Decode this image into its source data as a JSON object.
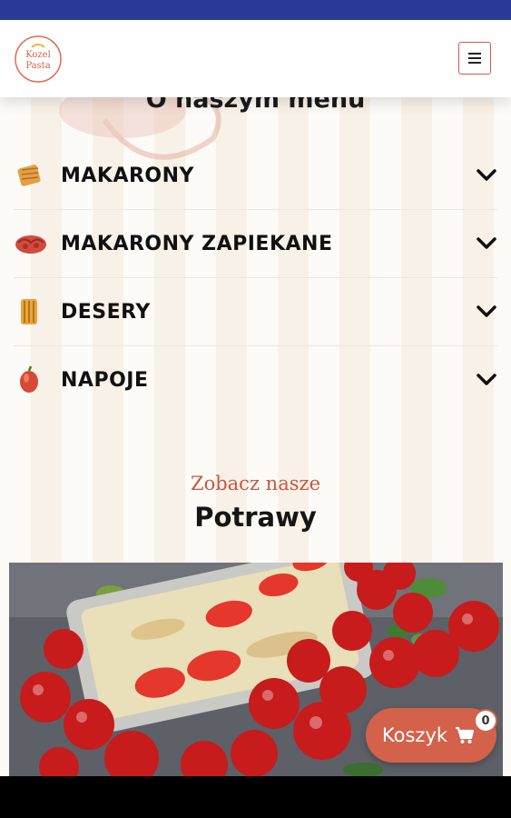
{
  "colors": {
    "status_bar": "#2b3a97",
    "accent": "#d4614a",
    "menu_button_border": "#d9534f",
    "subtitle": "#c9573f"
  },
  "header": {
    "logo_text": [
      "Kozel",
      "Pasta"
    ],
    "logo_icon": "brand-logo",
    "menu_icon": "hamburger-icon"
  },
  "menu": {
    "title": "O naszym menu",
    "categories": [
      {
        "label": "MAKARONY",
        "icon": "pasta-icon"
      },
      {
        "label": "MAKARONY ZAPIEKANE",
        "icon": "baked-pasta-icon"
      },
      {
        "label": "DESERY",
        "icon": "dessert-icon"
      },
      {
        "label": "NAPOJE",
        "icon": "drink-icon"
      }
    ]
  },
  "products": {
    "subtitle": "Zobacz nasze",
    "heading": "Potrawy",
    "image": "baked-pasta-with-cherry-tomatoes"
  },
  "cart": {
    "label": "Koszyk",
    "count": "0",
    "icon": "cart-icon"
  }
}
